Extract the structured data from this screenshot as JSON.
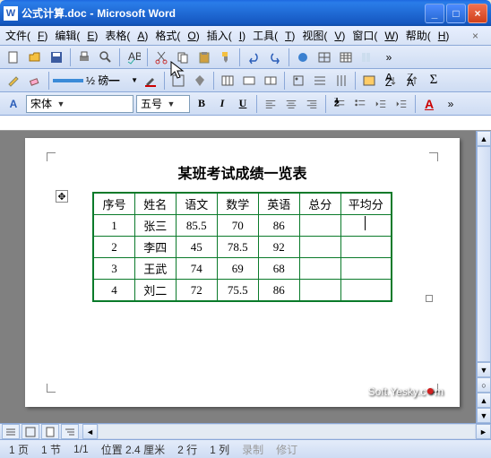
{
  "titlebar": {
    "filename": "公式计算.doc",
    "app": "Microsoft Word"
  },
  "menu": {
    "file": "文件(",
    "file_k": "F",
    "edit": "编辑(",
    "edit_k": "E",
    "view": "视图(",
    "view_k": "V",
    "insert": "插入(",
    "insert_k": "I",
    "format": "格式(",
    "format_k": "O",
    "tools": "工具(",
    "tools_k": "T",
    "table": "表格(",
    "table_k": "A",
    "window": "窗口(",
    "window_k": "W",
    "help": "帮助(",
    "help_k": "H"
  },
  "format_bar": {
    "style": "宋体",
    "size": "五号"
  },
  "doc": {
    "title": "某班考试成绩一览表",
    "headers": [
      "序号",
      "姓名",
      "语文",
      "数学",
      "英语",
      "总分",
      "平均分"
    ],
    "rows": [
      {
        "n": "1",
        "name": "张三",
        "c1": "85.5",
        "c2": "70",
        "c3": "86",
        "sum": "",
        "avg": ""
      },
      {
        "n": "2",
        "name": "李四",
        "c1": "45",
        "c2": "78.5",
        "c3": "92",
        "sum": "",
        "avg": ""
      },
      {
        "n": "3",
        "name": "王武",
        "c1": "74",
        "c2": "69",
        "c3": "68",
        "sum": "",
        "avg": ""
      },
      {
        "n": "4",
        "name": "刘二",
        "c1": "72",
        "c2": "75.5",
        "c3": "86",
        "sum": "",
        "avg": ""
      }
    ]
  },
  "status": {
    "page": "1 页",
    "section": "1 节",
    "pages": "1/1",
    "pos": "位置 2.4 厘米",
    "line": "2 行",
    "col": "1 列",
    "rec": "录制",
    "trk": "修订"
  },
  "watermark": "Soft.Yesky.c"
}
